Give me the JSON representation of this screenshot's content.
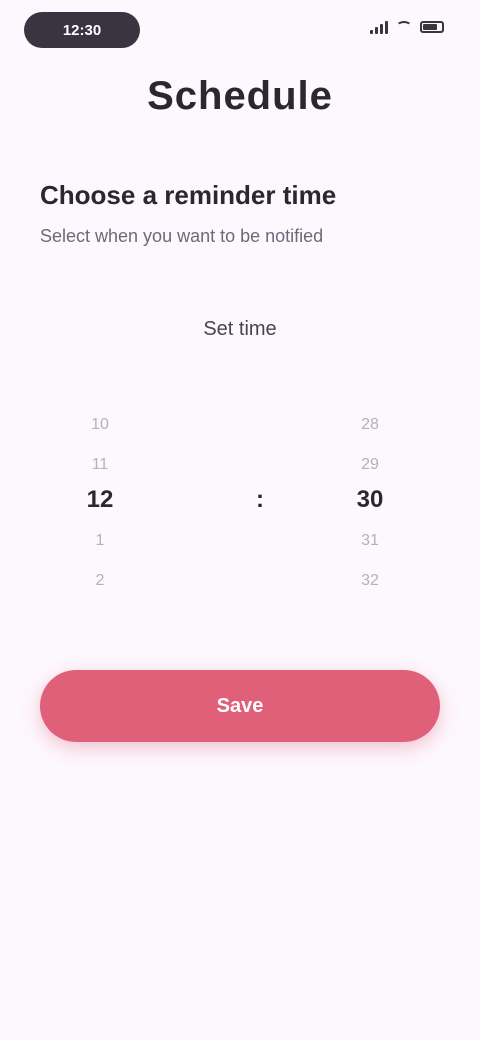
{
  "status_bar": {
    "time": "12:30",
    "icons": [
      "signal-icon",
      "wifi-icon",
      "battery-icon"
    ]
  },
  "page": {
    "title": "Schedule"
  },
  "card": {
    "heading": "Choose a reminder time",
    "subtitle": "Select when you want to be notified"
  },
  "picker": {
    "label": "Set time",
    "hours": {
      "above": [
        "10",
        "11"
      ],
      "selected": "12",
      "below": [
        "1",
        "2"
      ]
    },
    "separator": {
      "above": [
        "",
        ""
      ],
      "selected": ":",
      "below": [
        "",
        ""
      ]
    },
    "minutes": {
      "above": [
        "28",
        "29"
      ],
      "selected": "30",
      "below": [
        "31",
        "32"
      ]
    }
  },
  "actions": {
    "primary_label": "Save"
  },
  "colors": {
    "accent": "#e0607a",
    "background": "#fdf8fd",
    "text": "#2b2630"
  }
}
